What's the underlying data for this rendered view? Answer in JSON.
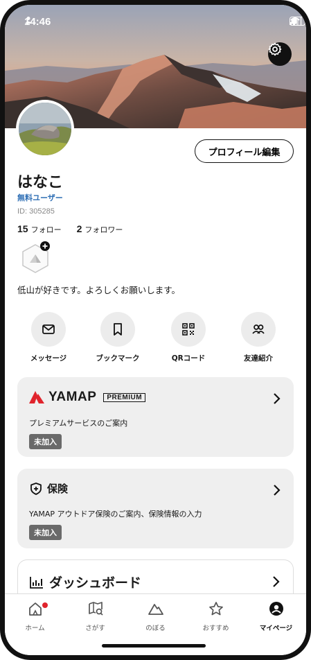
{
  "status_bar": {
    "time": "14:46"
  },
  "profile": {
    "name": "はなこ",
    "plan": "無料ユーザー",
    "id": "ID: 305285",
    "following_count": "15",
    "following_label": "フォロー",
    "followers_count": "2",
    "followers_label": "フォロワー",
    "bio": "低山が好きです。よろしくお願いします。",
    "edit_button": "プロフィール編集"
  },
  "actions": [
    {
      "label": "メッセージ",
      "icon": "mail-icon"
    },
    {
      "label": "ブックマーク",
      "icon": "bookmark-icon"
    },
    {
      "label": "QRコード",
      "icon": "qr-code-icon"
    },
    {
      "label": "友達紹介",
      "icon": "users-icon"
    }
  ],
  "premium_card": {
    "brand": "YAMAP",
    "badge": "PREMIUM",
    "description": "プレミアムサービスのご案内",
    "status": "未加入"
  },
  "insurance_card": {
    "title": "保険",
    "description": "YAMAP アウトドア保険のご案内、保険情報の入力",
    "status": "未加入"
  },
  "dashboard_card": {
    "title": "ダッシュボード"
  },
  "tabs": [
    {
      "label": "ホーム",
      "icon": "home-icon",
      "active": false
    },
    {
      "label": "さがす",
      "icon": "map-search-icon",
      "active": false
    },
    {
      "label": "のぼる",
      "icon": "mountain-icon",
      "active": false
    },
    {
      "label": "おすすめ",
      "icon": "star-icon",
      "active": false
    },
    {
      "label": "マイページ",
      "icon": "user-circle-icon",
      "active": true
    }
  ],
  "colors": {
    "brand_red": "#e0242c",
    "link_blue": "#2f6fb5",
    "card_bg": "#efefef"
  }
}
